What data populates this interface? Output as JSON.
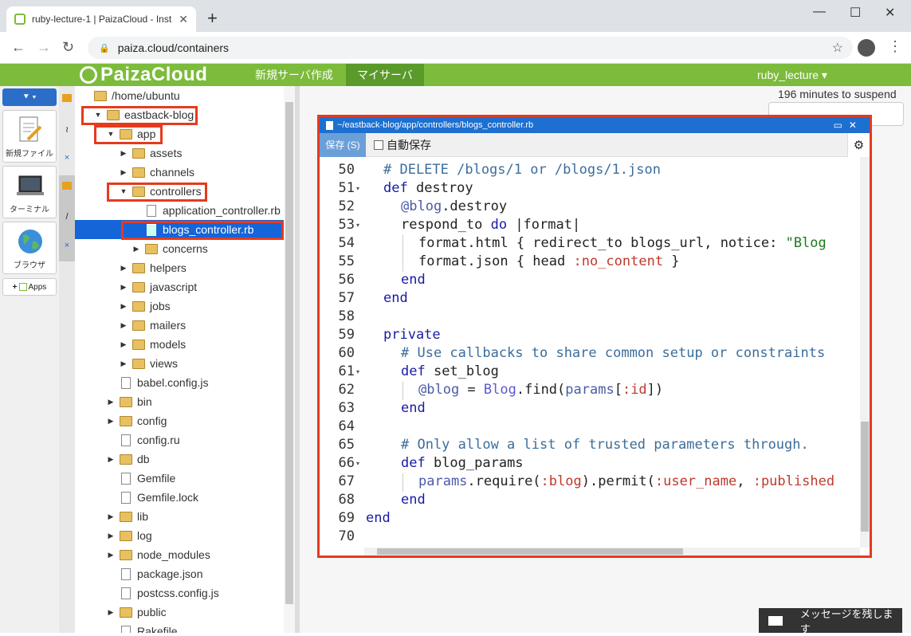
{
  "browser": {
    "tab_title": "ruby-lecture-1 | PaizaCloud - Inst",
    "tab_close": "✕",
    "new_tab": "+",
    "url": "paiza.cloud/containers",
    "min": "—",
    "max": "☐",
    "close": "✕"
  },
  "paiza": {
    "logo": "PaizaCloud",
    "menu": [
      "新規サーバ作成",
      "マイサーバ"
    ],
    "user": "ruby_lecture ▾"
  },
  "dock": {
    "new_file": "新規ファイル",
    "terminal": "ターミナル",
    "browser": "ブラウザ",
    "apps": "Apps"
  },
  "tree": [
    {
      "name": "/home/ubuntu",
      "type": "folder",
      "depth": 0,
      "arrow": ""
    },
    {
      "name": "eastback-blog",
      "type": "folder",
      "depth": 1,
      "arrow": "▼"
    },
    {
      "name": "app",
      "type": "folder",
      "depth": 2,
      "arrow": "▼"
    },
    {
      "name": "assets",
      "type": "folder",
      "depth": 3,
      "arrow": "▶"
    },
    {
      "name": "channels",
      "type": "folder",
      "depth": 3,
      "arrow": "▶"
    },
    {
      "name": "controllers",
      "type": "folder",
      "depth": 3,
      "arrow": "▼"
    },
    {
      "name": "application_controller.rb",
      "type": "file",
      "depth": 4,
      "arrow": ""
    },
    {
      "name": "blogs_controller.rb",
      "type": "file",
      "depth": 4,
      "arrow": "",
      "selected": true
    },
    {
      "name": "concerns",
      "type": "folder",
      "depth": 4,
      "arrow": "▶"
    },
    {
      "name": "helpers",
      "type": "folder",
      "depth": 3,
      "arrow": "▶"
    },
    {
      "name": "javascript",
      "type": "folder",
      "depth": 3,
      "arrow": "▶"
    },
    {
      "name": "jobs",
      "type": "folder",
      "depth": 3,
      "arrow": "▶"
    },
    {
      "name": "mailers",
      "type": "folder",
      "depth": 3,
      "arrow": "▶"
    },
    {
      "name": "models",
      "type": "folder",
      "depth": 3,
      "arrow": "▶"
    },
    {
      "name": "views",
      "type": "folder",
      "depth": 3,
      "arrow": "▶"
    },
    {
      "name": "babel.config.js",
      "type": "file",
      "depth": 2,
      "arrow": ""
    },
    {
      "name": "bin",
      "type": "folder",
      "depth": 2,
      "arrow": "▶"
    },
    {
      "name": "config",
      "type": "folder",
      "depth": 2,
      "arrow": "▶"
    },
    {
      "name": "config.ru",
      "type": "file",
      "depth": 2,
      "arrow": ""
    },
    {
      "name": "db",
      "type": "folder",
      "depth": 2,
      "arrow": "▶"
    },
    {
      "name": "Gemfile",
      "type": "file",
      "depth": 2,
      "arrow": ""
    },
    {
      "name": "Gemfile.lock",
      "type": "file",
      "depth": 2,
      "arrow": ""
    },
    {
      "name": "lib",
      "type": "folder",
      "depth": 2,
      "arrow": "▶"
    },
    {
      "name": "log",
      "type": "folder",
      "depth": 2,
      "arrow": "▶"
    },
    {
      "name": "node_modules",
      "type": "folder",
      "depth": 2,
      "arrow": "▶"
    },
    {
      "name": "package.json",
      "type": "file",
      "depth": 2,
      "arrow": ""
    },
    {
      "name": "postcss.config.js",
      "type": "file",
      "depth": 2,
      "arrow": ""
    },
    {
      "name": "public",
      "type": "folder",
      "depth": 2,
      "arrow": "▶"
    },
    {
      "name": "Rakefile",
      "type": "file",
      "depth": 2,
      "arrow": ""
    }
  ],
  "workspace": {
    "suspend": "196 minutes to suspend"
  },
  "editor": {
    "path": "~/eastback-blog/app/controllers/blogs_controller.rb",
    "save": "保存 (S)",
    "autosave": "自動保存",
    "lines": [
      {
        "n": "50",
        "fold": false,
        "indent": 1,
        "tokens": [
          [
            "cm",
            "# DELETE /blogs/1 or /blogs/1.json"
          ]
        ]
      },
      {
        "n": "51",
        "fold": true,
        "indent": 1,
        "tokens": [
          [
            "kw",
            "def"
          ],
          [
            "",
            " destroy"
          ]
        ]
      },
      {
        "n": "52",
        "fold": false,
        "indent": 2,
        "tokens": [
          [
            "iv",
            "@blog"
          ],
          [
            "",
            ".destroy"
          ]
        ]
      },
      {
        "n": "53",
        "fold": true,
        "indent": 2,
        "tokens": [
          [
            "",
            "respond_to "
          ],
          [
            "kw",
            "do"
          ],
          [
            "",
            " |format|"
          ]
        ]
      },
      {
        "n": "54",
        "fold": false,
        "indent": 3,
        "tokens": [
          [
            "",
            "format.html { redirect_to blogs_url, notice: "
          ],
          [
            "st",
            "\"Blog"
          ]
        ]
      },
      {
        "n": "55",
        "fold": false,
        "indent": 3,
        "tokens": [
          [
            "",
            "format.json { head "
          ],
          [
            "sym",
            ":no_content"
          ],
          [
            "",
            " }"
          ]
        ]
      },
      {
        "n": "56",
        "fold": false,
        "indent": 2,
        "tokens": [
          [
            "kw",
            "end"
          ]
        ]
      },
      {
        "n": "57",
        "fold": false,
        "indent": 1,
        "tokens": [
          [
            "kw",
            "end"
          ]
        ]
      },
      {
        "n": "58",
        "fold": false,
        "indent": 0,
        "tokens": []
      },
      {
        "n": "59",
        "fold": false,
        "indent": 1,
        "tokens": [
          [
            "kw",
            "private"
          ]
        ]
      },
      {
        "n": "60",
        "fold": false,
        "indent": 2,
        "tokens": [
          [
            "cm",
            "# Use callbacks to share common setup or constraints"
          ]
        ]
      },
      {
        "n": "61",
        "fold": true,
        "indent": 2,
        "tokens": [
          [
            "kw",
            "def"
          ],
          [
            "",
            " set_blog"
          ]
        ]
      },
      {
        "n": "62",
        "fold": false,
        "indent": 3,
        "tokens": [
          [
            "iv",
            "@blog"
          ],
          [
            "",
            " = "
          ],
          [
            "cn",
            "Blog"
          ],
          [
            "",
            ".find("
          ],
          [
            "iv",
            "params"
          ],
          [
            "",
            "["
          ],
          [
            "sym",
            ":id"
          ],
          [
            "",
            "])"
          ]
        ]
      },
      {
        "n": "63",
        "fold": false,
        "indent": 2,
        "tokens": [
          [
            "kw",
            "end"
          ]
        ]
      },
      {
        "n": "64",
        "fold": false,
        "indent": 0,
        "tokens": []
      },
      {
        "n": "65",
        "fold": false,
        "indent": 2,
        "tokens": [
          [
            "cm",
            "# Only allow a list of trusted parameters through."
          ]
        ]
      },
      {
        "n": "66",
        "fold": true,
        "indent": 2,
        "tokens": [
          [
            "kw",
            "def"
          ],
          [
            "",
            " blog_params"
          ]
        ]
      },
      {
        "n": "67",
        "fold": false,
        "indent": 3,
        "tokens": [
          [
            "iv",
            "params"
          ],
          [
            "",
            ".require("
          ],
          [
            "sym",
            ":blog"
          ],
          [
            "",
            ").permit("
          ],
          [
            "sym",
            ":user_name"
          ],
          [
            "",
            ", "
          ],
          [
            "sym",
            ":published"
          ]
        ]
      },
      {
        "n": "68",
        "fold": false,
        "indent": 2,
        "tokens": [
          [
            "kw",
            "end"
          ]
        ]
      },
      {
        "n": "69",
        "fold": false,
        "indent": 0,
        "tokens": [
          [
            "kw",
            "end"
          ]
        ]
      },
      {
        "n": "70",
        "fold": false,
        "indent": 0,
        "tokens": []
      }
    ]
  },
  "message": "メッセージを残します",
  "colors": {
    "paiza_green": "#7cbb3b",
    "highlight": "#e53a1e",
    "editor_title": "#1d6fd0"
  }
}
